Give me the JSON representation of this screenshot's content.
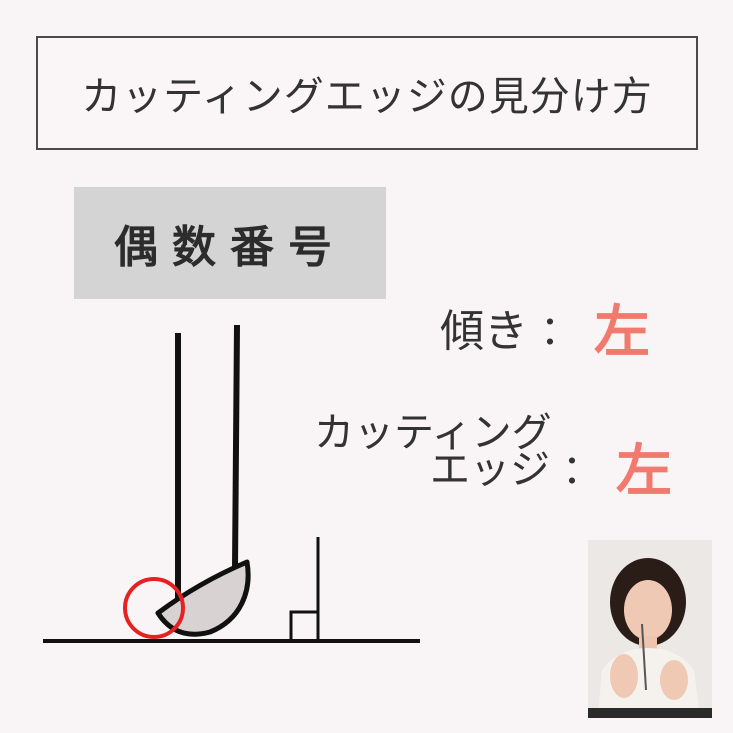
{
  "title": "カッティングエッジの見分け方",
  "category_label": "偶数番号",
  "tilt": {
    "key": "傾き",
    "colon": "：",
    "value": "左"
  },
  "cutting_edge": {
    "key_line1": "カッティング",
    "key_line2": "エッジ",
    "colon": "：",
    "value": "左"
  },
  "colors": {
    "accent": "#f07a6e",
    "highlight_circle": "#e52222",
    "label_bg": "#d4d4d4"
  }
}
